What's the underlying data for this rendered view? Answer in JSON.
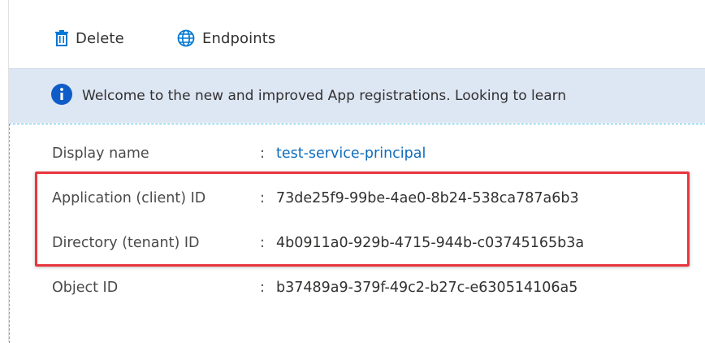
{
  "toolbar": {
    "delete_label": "Delete",
    "endpoints_label": "Endpoints"
  },
  "banner": {
    "message": "Welcome to the new and improved App registrations. Looking to learn"
  },
  "essentials": {
    "rows": [
      {
        "key": "Display name",
        "sep": ":",
        "value": "test-service-principal"
      },
      {
        "key": "Application (client) ID",
        "sep": ":",
        "value": "73de25f9-99be-4ae0-8b24-538ca787a6b3"
      },
      {
        "key": "Directory (tenant) ID",
        "sep": ":",
        "value": "4b0911a0-929b-4715-944b-c03745165b3a"
      },
      {
        "key": "Object ID",
        "sep": ":",
        "value": "b37489a9-379f-49c2-b27c-e630514106a5"
      }
    ]
  },
  "colors": {
    "accent": "#0078d4",
    "link": "#0f6cbd",
    "banner_bg": "#dde6f3",
    "highlight": "#e8373e"
  },
  "icons": {
    "delete": "trash-icon",
    "endpoints": "globe-icon",
    "banner": "info-icon"
  }
}
